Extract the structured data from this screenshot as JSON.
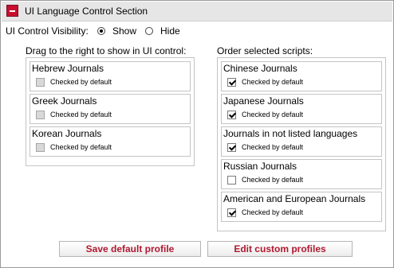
{
  "header": {
    "title": "UI Language Control Section"
  },
  "visibility": {
    "label": "UI Control Visibility:",
    "options": [
      {
        "label": "Show",
        "selected": true
      },
      {
        "label": "Hide",
        "selected": false
      }
    ]
  },
  "left_column": {
    "title": "Drag to the right to show in UI control:",
    "items": [
      {
        "name": "Hebrew Journals",
        "checkbox_label": "Checked by default",
        "checked": false,
        "disabled": true
      },
      {
        "name": "Greek Journals",
        "checkbox_label": "Checked by default",
        "checked": false,
        "disabled": true
      },
      {
        "name": "Korean Journals",
        "checkbox_label": "Checked by default",
        "checked": false,
        "disabled": true
      }
    ]
  },
  "right_column": {
    "title": "Order selected scripts:",
    "items": [
      {
        "name": "Chinese Journals",
        "checkbox_label": "Checked by default",
        "checked": true
      },
      {
        "name": "Japanese Journals",
        "checkbox_label": "Checked by default",
        "checked": true
      },
      {
        "name": "Journals in not listed languages",
        "checkbox_label": "Checked by default",
        "checked": true
      },
      {
        "name": "Russian Journals",
        "checkbox_label": "Checked by default",
        "checked": false
      },
      {
        "name": "American and European Journals",
        "checkbox_label": "Checked by default",
        "checked": true
      }
    ]
  },
  "buttons": {
    "save_default": "Save default profile",
    "edit_custom": "Edit custom profiles"
  },
  "colors": {
    "accent": "#c8102e",
    "button_text": "#b01830",
    "header_bg": "#e6e6e6"
  }
}
